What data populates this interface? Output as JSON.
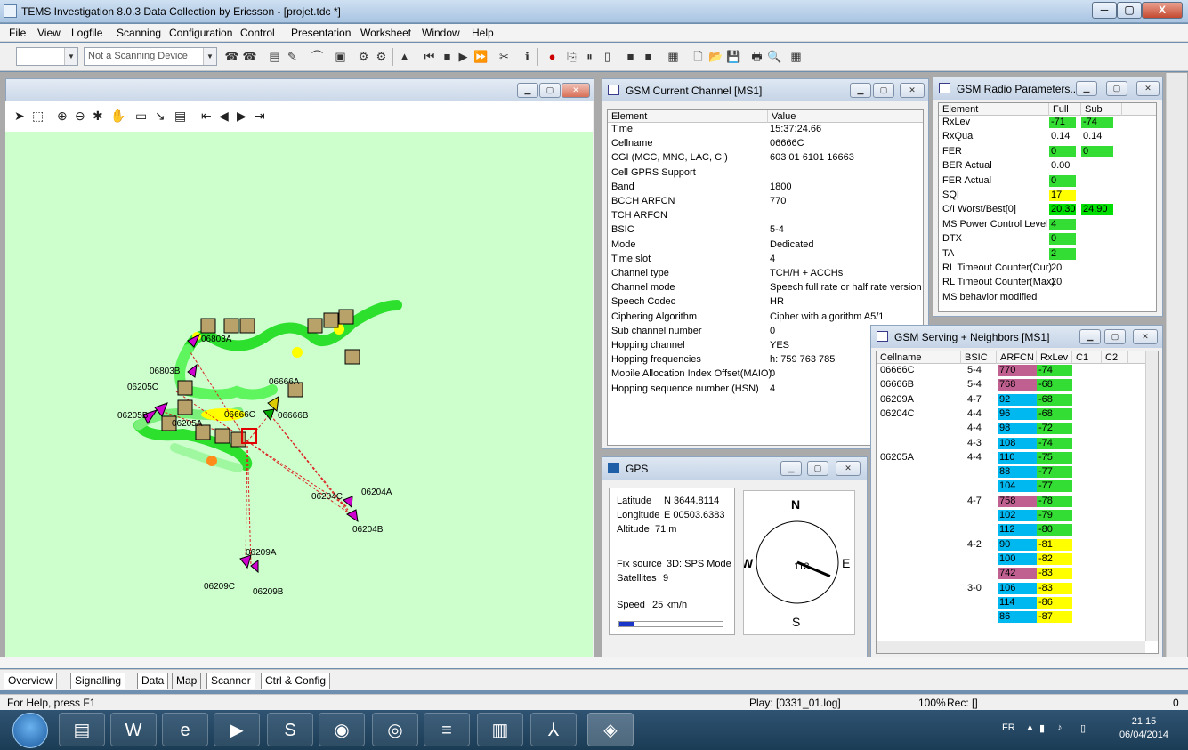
{
  "window": {
    "title": "TEMS Investigation 8.0.3 Data Collection by Ericsson - [projet.tdc *]",
    "min": "─",
    "max": "▢",
    "close": "X"
  },
  "menu": [
    "File",
    "View",
    "Logfile",
    "Scanning",
    "Configuration",
    "Control",
    "Presentation",
    "Worksheet",
    "Window",
    "Help"
  ],
  "toolbar": {
    "combo1": "",
    "device": "Not a Scanning Device"
  },
  "current_channel": {
    "title": "GSM Current Channel [MS1]",
    "headers": [
      "Element",
      "Value"
    ],
    "rows": [
      [
        "Time",
        "15:37:24.66"
      ],
      [
        "Cellname",
        "06666C"
      ],
      [
        "CGI (MCC, MNC, LAC, CI)",
        "603 01 6101 16663"
      ],
      [
        "Cell GPRS Support",
        ""
      ],
      [
        "Band",
        "1800"
      ],
      [
        "BCCH ARFCN",
        "770"
      ],
      [
        "TCH ARFCN",
        ""
      ],
      [
        "BSIC",
        "5-4"
      ],
      [
        "Mode",
        "Dedicated"
      ],
      [
        "Time slot",
        "4"
      ],
      [
        "Channel type",
        "TCH/H + ACCHs"
      ],
      [
        "Channel mode",
        "Speech full rate or half rate version ..."
      ],
      [
        "Speech Codec",
        "HR"
      ],
      [
        "Ciphering Algorithm",
        "Cipher with algorithm A5/1"
      ],
      [
        "Sub channel number",
        "0"
      ],
      [
        "Hopping channel",
        "YES"
      ],
      [
        "Hopping frequencies",
        "h: 759 763 785"
      ],
      [
        "Mobile Allocation Index Offset(MAIO)",
        "0"
      ],
      [
        "Hopping sequence number (HSN)",
        "4"
      ]
    ]
  },
  "radio_params": {
    "title": "GSM Radio Parameters...",
    "headers": [
      "Element",
      "Full",
      "Sub"
    ],
    "rows": [
      {
        "el": "RxLev",
        "full": "-71",
        "sub": "-74",
        "fc": "#33dd33",
        "sc": "#33dd33"
      },
      {
        "el": "RxQual",
        "full": "0.14",
        "sub": "0.14",
        "fc": "",
        "sc": ""
      },
      {
        "el": "FER",
        "full": "0",
        "sub": "0",
        "fc": "#33dd33",
        "sc": "#33dd33"
      },
      {
        "el": "BER Actual",
        "full": "0.00",
        "sub": "",
        "fc": "",
        "sc": ""
      },
      {
        "el": "FER Actual",
        "full": "0",
        "sub": "",
        "fc": "#33dd33",
        "sc": ""
      },
      {
        "el": "SQI",
        "full": "17",
        "sub": "",
        "fc": "#ffff00",
        "sc": ""
      },
      {
        "el": "C/I Worst/Best[0]",
        "full": "20.30",
        "sub": "24.90",
        "fc": "#00dd00",
        "sc": "#00dd00"
      },
      {
        "el": "MS Power Control Level",
        "full": "4",
        "sub": "",
        "fc": "#33dd33",
        "sc": ""
      },
      {
        "el": "DTX",
        "full": "0",
        "sub": "",
        "fc": "#33dd33",
        "sc": ""
      },
      {
        "el": "TA",
        "full": "2",
        "sub": "",
        "fc": "#33dd33",
        "sc": ""
      },
      {
        "el": "RL Timeout Counter(Cur)",
        "full": "20",
        "sub": "",
        "fc": "",
        "sc": ""
      },
      {
        "el": "RL Timeout Counter(Max)",
        "full": "20",
        "sub": "",
        "fc": "",
        "sc": ""
      },
      {
        "el": "MS behavior modified",
        "full": "",
        "sub": "",
        "fc": "",
        "sc": ""
      }
    ]
  },
  "neighbors": {
    "title": "GSM Serving + Neighbors [MS1]",
    "headers": [
      "Cellname",
      "BSIC",
      "ARFCN",
      "RxLev",
      "C1",
      "C2"
    ],
    "rows": [
      {
        "cell": "06666C",
        "bsic": "5-4",
        "arfcn": "770",
        "rxlev": "-74",
        "ac": "#c06090",
        "rc": "#33dd33"
      },
      {
        "cell": "06666B",
        "bsic": "5-4",
        "arfcn": "768",
        "rxlev": "-68",
        "ac": "#c06090",
        "rc": "#33dd33"
      },
      {
        "cell": "06209A",
        "bsic": "4-7",
        "arfcn": "92",
        "rxlev": "-68",
        "ac": "#00b8f0",
        "rc": "#33dd33"
      },
      {
        "cell": "06204C",
        "bsic": "4-4",
        "arfcn": "96",
        "rxlev": "-68",
        "ac": "#00b8f0",
        "rc": "#33dd33"
      },
      {
        "cell": "",
        "bsic": "4-4",
        "arfcn": "98",
        "rxlev": "-72",
        "ac": "#00b8f0",
        "rc": "#33dd33"
      },
      {
        "cell": "",
        "bsic": "4-3",
        "arfcn": "108",
        "rxlev": "-74",
        "ac": "#00b8f0",
        "rc": "#33dd33"
      },
      {
        "cell": "06205A",
        "bsic": "4-4",
        "arfcn": "110",
        "rxlev": "-75",
        "ac": "#00b8f0",
        "rc": "#33dd33"
      },
      {
        "cell": "",
        "bsic": "",
        "arfcn": "88",
        "rxlev": "-77",
        "ac": "#00b8f0",
        "rc": "#33dd33"
      },
      {
        "cell": "",
        "bsic": "",
        "arfcn": "104",
        "rxlev": "-77",
        "ac": "#00b8f0",
        "rc": "#33dd33"
      },
      {
        "cell": "",
        "bsic": "4-7",
        "arfcn": "758",
        "rxlev": "-78",
        "ac": "#c06090",
        "rc": "#33dd33"
      },
      {
        "cell": "",
        "bsic": "",
        "arfcn": "102",
        "rxlev": "-79",
        "ac": "#00b8f0",
        "rc": "#33dd33"
      },
      {
        "cell": "",
        "bsic": "",
        "arfcn": "112",
        "rxlev": "-80",
        "ac": "#00b8f0",
        "rc": "#33dd33"
      },
      {
        "cell": "",
        "bsic": "4-2",
        "arfcn": "90",
        "rxlev": "-81",
        "ac": "#00b8f0",
        "rc": "#ffff00"
      },
      {
        "cell": "",
        "bsic": "",
        "arfcn": "100",
        "rxlev": "-82",
        "ac": "#00b8f0",
        "rc": "#ffff00"
      },
      {
        "cell": "",
        "bsic": "",
        "arfcn": "742",
        "rxlev": "-83",
        "ac": "#c06090",
        "rc": "#ffff00"
      },
      {
        "cell": "",
        "bsic": "3-0",
        "arfcn": "106",
        "rxlev": "-83",
        "ac": "#00b8f0",
        "rc": "#ffff00"
      },
      {
        "cell": "",
        "bsic": "",
        "arfcn": "114",
        "rxlev": "-86",
        "ac": "#00b8f0",
        "rc": "#ffff00"
      },
      {
        "cell": "",
        "bsic": "",
        "arfcn": "86",
        "rxlev": "-87",
        "ac": "#00b8f0",
        "rc": "#ffff00"
      }
    ]
  },
  "gps": {
    "title": "GPS",
    "lat_label": "Latitude",
    "lat": "N 3644.8114",
    "lon_label": "Longitude",
    "lon": "E 00503.6383",
    "alt_label": "Altitude",
    "alt": "71 m",
    "fix_label": "Fix source",
    "fix": "3D: SPS Mode",
    "sat_label": "Satellites",
    "sat": "9",
    "speed_label": "Speed",
    "speed": "25 km/h",
    "speed_fraction": 0.15,
    "compass": {
      "n": "N",
      "s": "S",
      "e": "E",
      "w": "W",
      "heading": "113"
    }
  },
  "map": {
    "cells": [
      "06803A",
      "06803B",
      "06205C",
      "06205B",
      "06205A",
      "06666C",
      "06666A",
      "06666B",
      "06204C",
      "06204A",
      "06204B",
      "06209A",
      "06209C",
      "06209B"
    ]
  },
  "tabs": [
    "Overview",
    "Signalling",
    "Data",
    "Map",
    "Scanner",
    "Ctrl & Config"
  ],
  "active_tab": "Map",
  "status": {
    "help": "For Help, press F1",
    "play": "Play: [0331_01.log]",
    "zoom": "100%",
    "rec": "Rec: []",
    "count": "0"
  },
  "taskbar": {
    "lang": "FR",
    "time": "21:15",
    "date": "06/04/2014"
  },
  "colors": {
    "map_bg": "#ccffcc",
    "good": "#33dd33",
    "warn": "#ffff00",
    "arfcn_1800": "#c06090",
    "arfcn_900": "#00b8f0"
  }
}
